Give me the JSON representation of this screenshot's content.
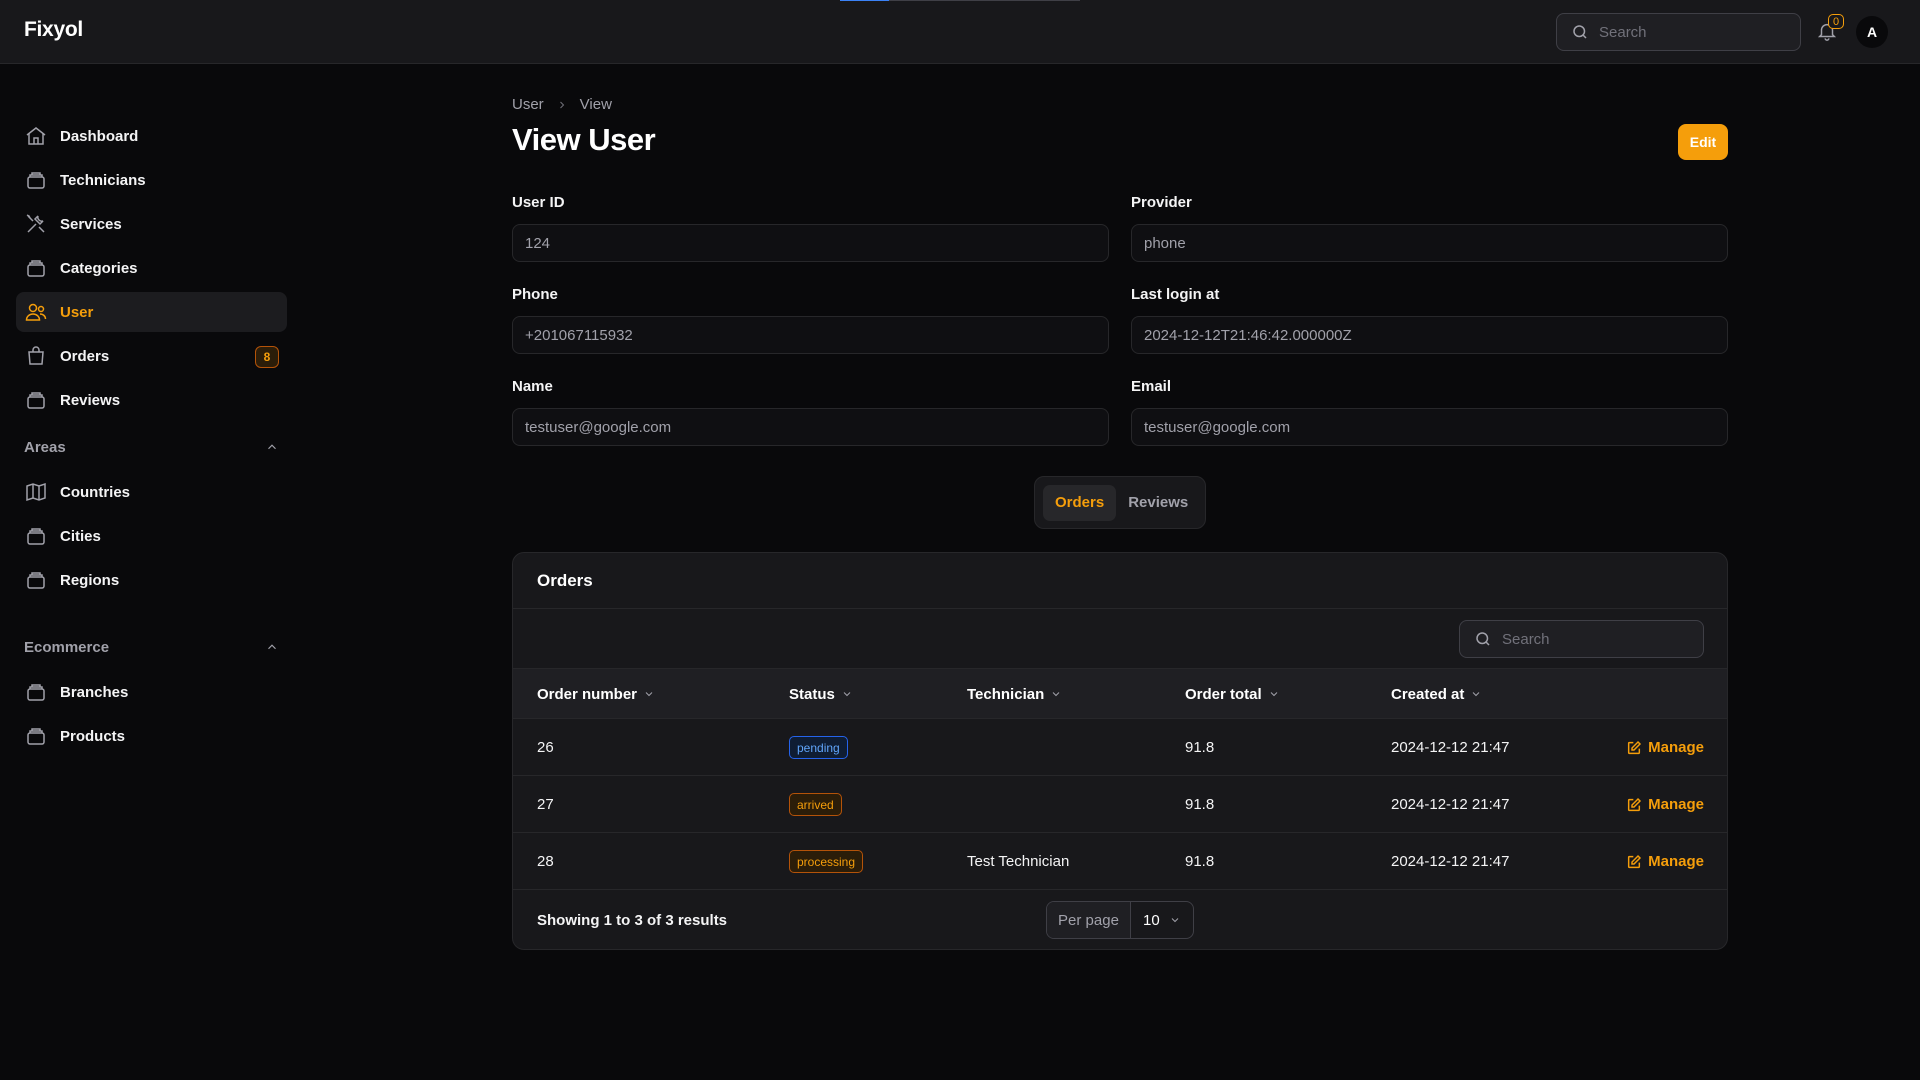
{
  "app": {
    "brand": "Fixyol"
  },
  "topbar": {
    "search_placeholder": "Search",
    "notification_count": "0",
    "avatar_initial": "A"
  },
  "sidebar": {
    "items": [
      {
        "label": "Dashboard",
        "icon": "home-icon"
      },
      {
        "label": "Technicians",
        "icon": "box-icon"
      },
      {
        "label": "Services",
        "icon": "wrench-screwdriver-icon"
      },
      {
        "label": "Categories",
        "icon": "box-icon"
      },
      {
        "label": "User",
        "icon": "users-icon",
        "active": true
      },
      {
        "label": "Orders",
        "icon": "shopping-bag-icon",
        "badge": "8"
      },
      {
        "label": "Reviews",
        "icon": "box-icon"
      }
    ],
    "groups": [
      {
        "label": "Areas",
        "items": [
          {
            "label": "Countries",
            "icon": "map-icon"
          },
          {
            "label": "Cities",
            "icon": "box-icon"
          },
          {
            "label": "Regions",
            "icon": "box-icon"
          }
        ]
      },
      {
        "label": "Ecommerce",
        "items": [
          {
            "label": "Branches",
            "icon": "box-icon"
          },
          {
            "label": "Products",
            "icon": "box-icon"
          }
        ]
      }
    ]
  },
  "breadcrumb": {
    "parent": "User",
    "current": "View"
  },
  "page": {
    "title": "View User",
    "edit_label": "Edit"
  },
  "fields": {
    "user_id": {
      "label": "User ID",
      "value": "124"
    },
    "provider": {
      "label": "Provider",
      "value": "phone"
    },
    "phone": {
      "label": "Phone",
      "value": "+201067115932"
    },
    "last_login": {
      "label": "Last login at",
      "value": "2024-12-12T21:46:42.000000Z"
    },
    "name": {
      "label": "Name",
      "value": "testuser@google.com"
    },
    "email": {
      "label": "Email",
      "value": "testuser@google.com"
    }
  },
  "tabs": [
    {
      "label": "Orders",
      "active": true
    },
    {
      "label": "Reviews"
    }
  ],
  "orders": {
    "title": "Orders",
    "search_placeholder": "Search",
    "columns": [
      "Order number",
      "Status",
      "Technician",
      "Order total",
      "Created at"
    ],
    "rows": [
      {
        "number": "26",
        "status": "pending",
        "technician": "",
        "total": "91.8",
        "created": "2024-12-12 21:47",
        "action": "Manage"
      },
      {
        "number": "27",
        "status": "arrived",
        "technician": "",
        "total": "91.8",
        "created": "2024-12-12 21:47",
        "action": "Manage"
      },
      {
        "number": "28",
        "status": "processing",
        "technician": "Test Technician",
        "total": "91.8",
        "created": "2024-12-12 21:47",
        "action": "Manage"
      }
    ],
    "showing": "Showing 1 to 3 of 3 results",
    "per_page_label": "Per page",
    "per_page_value": "10"
  },
  "colors": {
    "accent": "#f59e0b",
    "background": "#09090b",
    "surface": "#18181b",
    "info": "#60a5fa"
  }
}
